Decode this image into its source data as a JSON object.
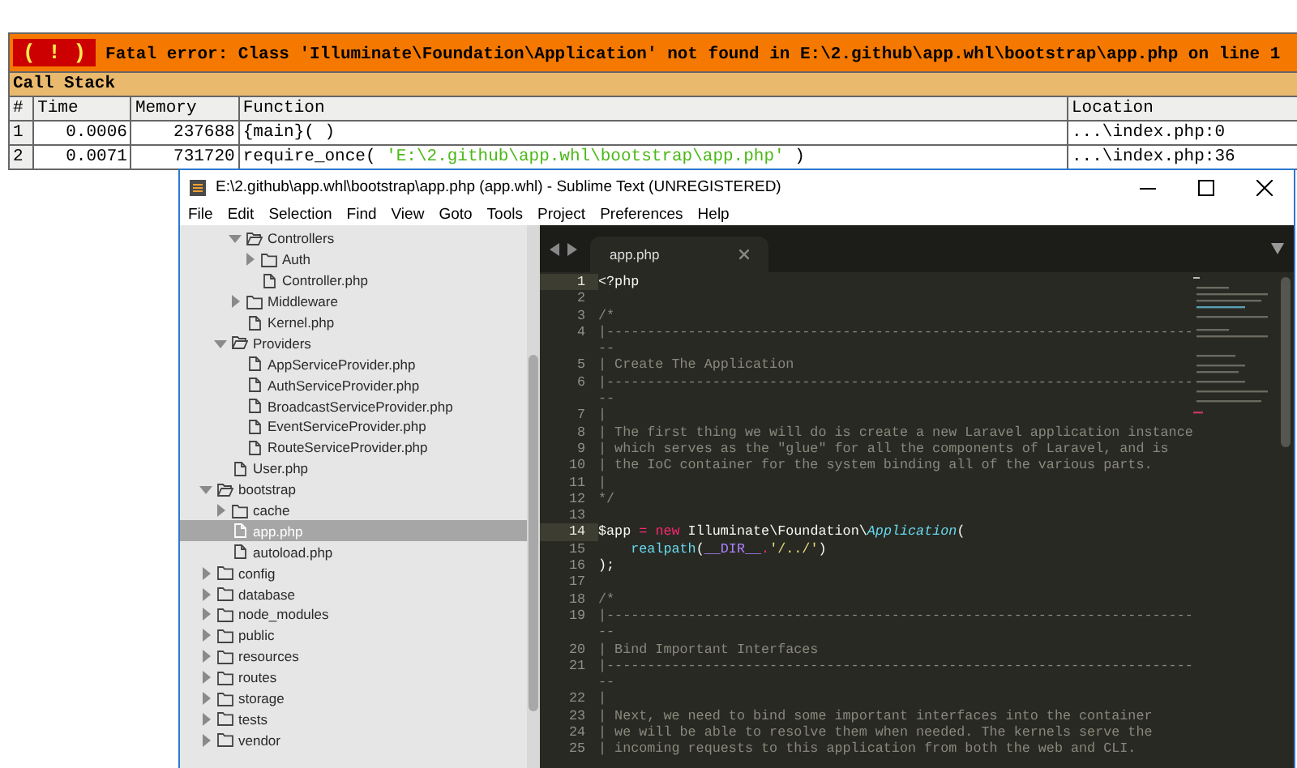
{
  "error_report": {
    "badge": "( ! )",
    "message": "Fatal error: Class 'Illuminate\\Foundation\\Application' not found in E:\\2.github\\app.whl\\bootstrap\\app.php on line 1",
    "call_stack_title": "Call Stack",
    "columns": [
      "#",
      "Time",
      "Memory",
      "Function",
      "Location"
    ],
    "rows": [
      {
        "index": "1",
        "time": "0.0006",
        "memory": "237688",
        "function": [
          {
            "kind": "plain",
            "text": "{main}( )"
          }
        ],
        "location": "...\\index.php:0"
      },
      {
        "index": "2",
        "time": "0.0071",
        "memory": "731720",
        "function": [
          {
            "kind": "plain",
            "text": "require_once( "
          },
          {
            "kind": "string",
            "text": "'E:\\2.github\\app.whl\\bootstrap\\app.php'"
          },
          {
            "kind": "plain",
            "text": " )"
          }
        ],
        "location": "...\\index.php:36"
      }
    ]
  },
  "window": {
    "title": "E:\\2.github\\app.whl\\bootstrap\\app.php (app.whl) - Sublime Text (UNREGISTERED)",
    "menu": [
      "File",
      "Edit",
      "Selection",
      "Find",
      "View",
      "Goto",
      "Tools",
      "Project",
      "Preferences",
      "Help"
    ],
    "sidebar": {
      "tree": [
        {
          "children": [
            {
              "children": [
                {
                  "label": "Controllers",
                  "kind": "folder",
                  "expanded": true,
                  "selected": false,
                  "children": [
                    {
                      "label": "Auth",
                      "kind": "folder",
                      "expanded": false,
                      "selected": false
                    },
                    {
                      "label": "Controller.php",
                      "kind": "file",
                      "selected": false
                    }
                  ]
                },
                {
                  "label": "Middleware",
                  "kind": "folder",
                  "expanded": false,
                  "selected": false
                },
                {
                  "label": "Kernel.php",
                  "kind": "file",
                  "selected": false
                }
              ]
            },
            {
              "label": "Providers",
              "kind": "folder",
              "expanded": true,
              "selected": false,
              "children": [
                {
                  "label": "AppServiceProvider.php",
                  "kind": "file",
                  "selected": false
                },
                {
                  "label": "AuthServiceProvider.php",
                  "kind": "file",
                  "selected": false
                },
                {
                  "label": "BroadcastServiceProvider.php",
                  "kind": "file",
                  "selected": false
                },
                {
                  "label": "EventServiceProvider.php",
                  "kind": "file",
                  "selected": false
                },
                {
                  "label": "RouteServiceProvider.php",
                  "kind": "file",
                  "selected": false
                }
              ]
            },
            {
              "label": "User.php",
              "kind": "file",
              "selected": false
            }
          ]
        },
        {
          "label": "bootstrap",
          "kind": "folder",
          "expanded": true,
          "selected": false,
          "children": [
            {
              "label": "cache",
              "kind": "folder",
              "expanded": false,
              "selected": false
            },
            {
              "label": "app.php",
              "kind": "file",
              "selected": true
            },
            {
              "label": "autoload.php",
              "kind": "file",
              "selected": false
            }
          ]
        },
        {
          "label": "config",
          "kind": "folder",
          "expanded": false,
          "selected": false
        },
        {
          "label": "database",
          "kind": "folder",
          "expanded": false,
          "selected": false
        },
        {
          "label": "node_modules",
          "kind": "folder",
          "expanded": false,
          "selected": false
        },
        {
          "label": "public",
          "kind": "folder",
          "expanded": false,
          "selected": false
        },
        {
          "label": "resources",
          "kind": "folder",
          "expanded": false,
          "selected": false
        },
        {
          "label": "routes",
          "kind": "folder",
          "expanded": false,
          "selected": false
        },
        {
          "label": "storage",
          "kind": "folder",
          "expanded": false,
          "selected": false
        },
        {
          "label": "tests",
          "kind": "folder",
          "expanded": false,
          "selected": false
        },
        {
          "label": "vendor",
          "kind": "folder",
          "expanded": false,
          "selected": false
        }
      ]
    },
    "tabs": [
      {
        "label": "app.php",
        "selected": true
      }
    ],
    "code": [
      {
        "num": "1",
        "current": true,
        "segments": [
          {
            "kind": "plain",
            "text": "<?php"
          }
        ]
      },
      {
        "num": "2",
        "current": false
      },
      {
        "num": "3",
        "current": false,
        "segments": [
          {
            "kind": "comment",
            "text": "/*"
          }
        ]
      },
      {
        "num": "4",
        "current": false,
        "segments": [
          {
            "kind": "comment",
            "text": "|------------------------------------------------------------------------"
          }
        ],
        "wrap": "--"
      },
      {
        "num": "5",
        "current": false,
        "segments": [
          {
            "kind": "comment",
            "text": "| Create The Application"
          }
        ]
      },
      {
        "num": "6",
        "current": false,
        "segments": [
          {
            "kind": "comment",
            "text": "|------------------------------------------------------------------------"
          }
        ],
        "wrap": "--"
      },
      {
        "num": "7",
        "current": false,
        "segments": [
          {
            "kind": "comment",
            "text": "|"
          }
        ]
      },
      {
        "num": "8",
        "current": false,
        "segments": [
          {
            "kind": "comment",
            "text": "| The first thing we will do is create a new Laravel application instance"
          }
        ]
      },
      {
        "num": "9",
        "current": false,
        "segments": [
          {
            "kind": "comment",
            "text": "| which serves as the \"glue\" for all the components of Laravel, and is"
          }
        ]
      },
      {
        "num": "10",
        "current": false,
        "segments": [
          {
            "kind": "comment",
            "text": "| the IoC container for the system binding all of the various parts."
          }
        ]
      },
      {
        "num": "11",
        "current": false,
        "segments": [
          {
            "kind": "comment",
            "text": "|"
          }
        ]
      },
      {
        "num": "12",
        "current": false,
        "segments": [
          {
            "kind": "comment",
            "text": "*/"
          }
        ]
      },
      {
        "num": "13",
        "current": false
      },
      {
        "num": "14",
        "current": true,
        "segments": [
          {
            "kind": "plain",
            "text": "$app "
          },
          {
            "kind": "keyword",
            "text": "= new"
          },
          {
            "kind": "plain",
            "text": " Illuminate\\Foundation\\"
          },
          {
            "kind": "class",
            "text": "Application"
          },
          {
            "kind": "plain",
            "text": "("
          }
        ]
      },
      {
        "num": "15",
        "current": false,
        "segments": [
          {
            "kind": "func",
            "text": "    realpath"
          },
          {
            "kind": "plain",
            "text": "("
          },
          {
            "kind": "const",
            "text": "__DIR__"
          },
          {
            "kind": "keyword",
            "text": "."
          },
          {
            "kind": "string",
            "text": "'/../'"
          },
          {
            "kind": "plain",
            "text": ")"
          }
        ]
      },
      {
        "num": "16",
        "current": false,
        "segments": [
          {
            "kind": "plain",
            "text": ");"
          }
        ]
      },
      {
        "num": "17",
        "current": false
      },
      {
        "num": "18",
        "current": false,
        "segments": [
          {
            "kind": "comment",
            "text": "/*"
          }
        ]
      },
      {
        "num": "19",
        "current": false,
        "segments": [
          {
            "kind": "comment",
            "text": "|------------------------------------------------------------------------"
          }
        ],
        "wrap": "--"
      },
      {
        "num": "20",
        "current": false,
        "segments": [
          {
            "kind": "comment",
            "text": "| Bind Important Interfaces"
          }
        ]
      },
      {
        "num": "21",
        "current": false,
        "segments": [
          {
            "kind": "comment",
            "text": "|------------------------------------------------------------------------"
          }
        ],
        "wrap": "--"
      },
      {
        "num": "22",
        "current": false,
        "segments": [
          {
            "kind": "comment",
            "text": "|"
          }
        ]
      },
      {
        "num": "23",
        "current": false,
        "segments": [
          {
            "kind": "comment",
            "text": "| Next, we need to bind some important interfaces into the container"
          }
        ]
      },
      {
        "num": "24",
        "current": false,
        "segments": [
          {
            "kind": "comment",
            "text": "| we will be able to resolve them when needed. The kernels serve the"
          }
        ]
      },
      {
        "num": "25",
        "current": false,
        "segments": [
          {
            "kind": "comment",
            "text": "| incoming requests to this application from both the web and CLI."
          }
        ]
      }
    ]
  }
}
